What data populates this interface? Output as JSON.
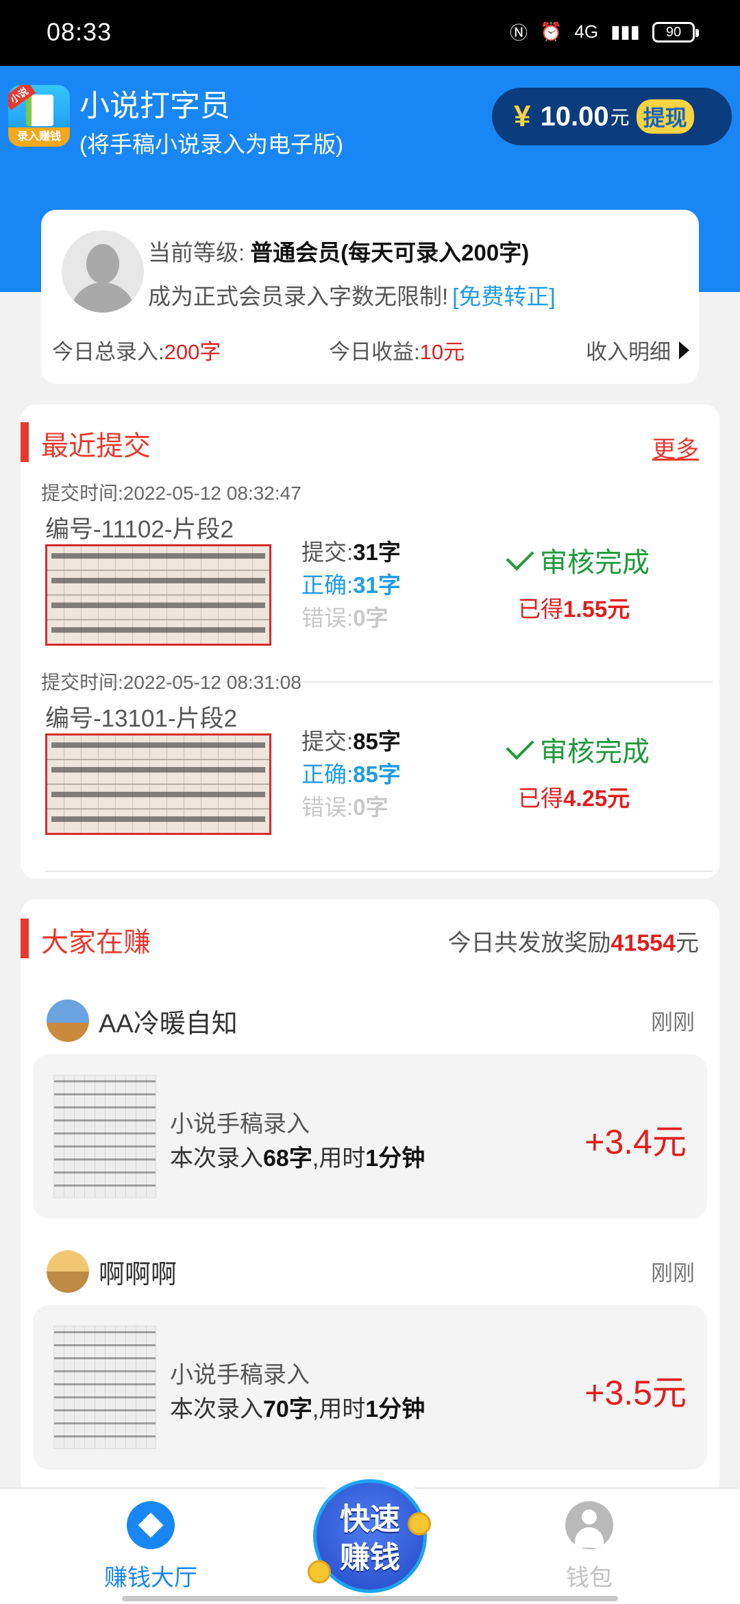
{
  "status_bar": {
    "time": "08:33",
    "battery": "90",
    "network": "4G"
  },
  "header": {
    "app_title": "小说打字员",
    "app_subtitle": "(将手稿小说录入为电子版)",
    "logo_tag": "小说",
    "logo_band": "录入赚钱",
    "yen": "¥",
    "balance": "10.00",
    "balance_unit": "元",
    "withdraw_label": "提现"
  },
  "member": {
    "level_label": "当前等级:",
    "level_value": "普通会员(每天可录入200字)",
    "upgrade_text": "成为正式会员录入字数无限制!",
    "upgrade_link": "[免费转正]",
    "today_total_label": "今日总录入:",
    "today_total_value": "200字",
    "today_income_label": "今日收益:",
    "today_income_value": "10元",
    "income_detail": "收入明细"
  },
  "recent": {
    "title": "最近提交",
    "more": "更多",
    "items": [
      {
        "time": "提交时间:2022-05-12 08:32:47",
        "code": "编号-11102-片段2",
        "submit_label": "提交:",
        "submit_value": "31字",
        "correct_label": "正确:",
        "correct_value": "31字",
        "wrong_label": "错误:",
        "wrong_value": "0字",
        "status": "审核完成",
        "earned_label": "已得",
        "earned_value": "1.55元"
      },
      {
        "time": "提交时间:2022-05-12 08:31:08",
        "code": "编号-13101-片段2",
        "submit_label": "提交:",
        "submit_value": "85字",
        "correct_label": "正确:",
        "correct_value": "85字",
        "wrong_label": "错误:",
        "wrong_value": "0字",
        "status": "审核完成",
        "earned_label": "已得",
        "earned_value": "4.25元"
      }
    ]
  },
  "earning": {
    "title": "大家在赚",
    "reward_prefix": "今日共发放奖励",
    "reward_value": "41554",
    "reward_suffix": "元",
    "items": [
      {
        "user": "AA冷暖自知",
        "time": "刚刚",
        "task": "小说手稿录入",
        "detail_prefix": "本次录入",
        "chars": "68字",
        "detail_mid": ",用时",
        "duration": "1分钟",
        "amount": "+3.4元"
      },
      {
        "user": "啊啊啊",
        "time": "刚刚",
        "task": "小说手稿录入",
        "detail_prefix": "本次录入",
        "chars": "70字",
        "detail_mid": ",用时",
        "duration": "1分钟",
        "amount": "+3.5元"
      }
    ]
  },
  "nav": {
    "home_label": "赚钱大厅",
    "fab_line1": "快速",
    "fab_line2": "赚钱",
    "wallet_label": "钱包"
  },
  "colors": {
    "primary_blue": "#1887f5",
    "accent_red": "#e8392e",
    "success_green": "#1f9a3a",
    "link_blue": "#1e9be8",
    "gold": "#f6d343"
  }
}
